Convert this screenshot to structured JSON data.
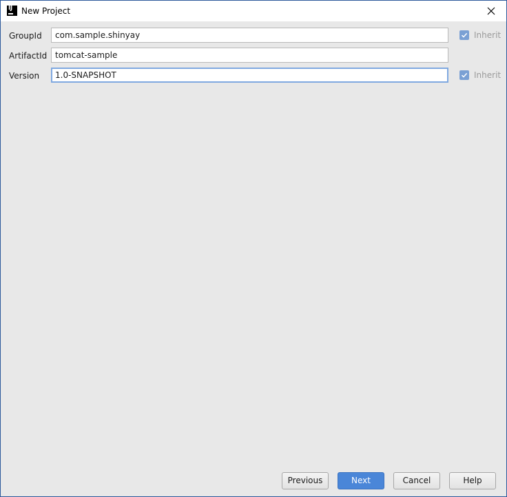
{
  "window": {
    "title": "New Project",
    "app_icon_text": "IJ"
  },
  "form": {
    "group_id": {
      "label": "GroupId",
      "value": "com.sample.shinyay",
      "inherit_label": "Inherit",
      "inherit_checked": true
    },
    "artifact_id": {
      "label": "ArtifactId",
      "value": "tomcat-sample"
    },
    "version": {
      "label": "Version",
      "value": "1.0-SNAPSHOT",
      "inherit_label": "Inherit",
      "inherit_checked": true
    }
  },
  "buttons": {
    "previous": "Previous",
    "next": "Next",
    "cancel": "Cancel",
    "help": "Help"
  },
  "colors": {
    "window_border": "#2b579a",
    "dialog_background": "#e8e8e8",
    "primary_button": "#4a86d8",
    "checkbox_fill": "#7aa0d4",
    "focus_ring": "#7fa8e0"
  },
  "icons": {
    "app": "intellij-icon",
    "close": "close-icon",
    "check": "check-icon"
  }
}
